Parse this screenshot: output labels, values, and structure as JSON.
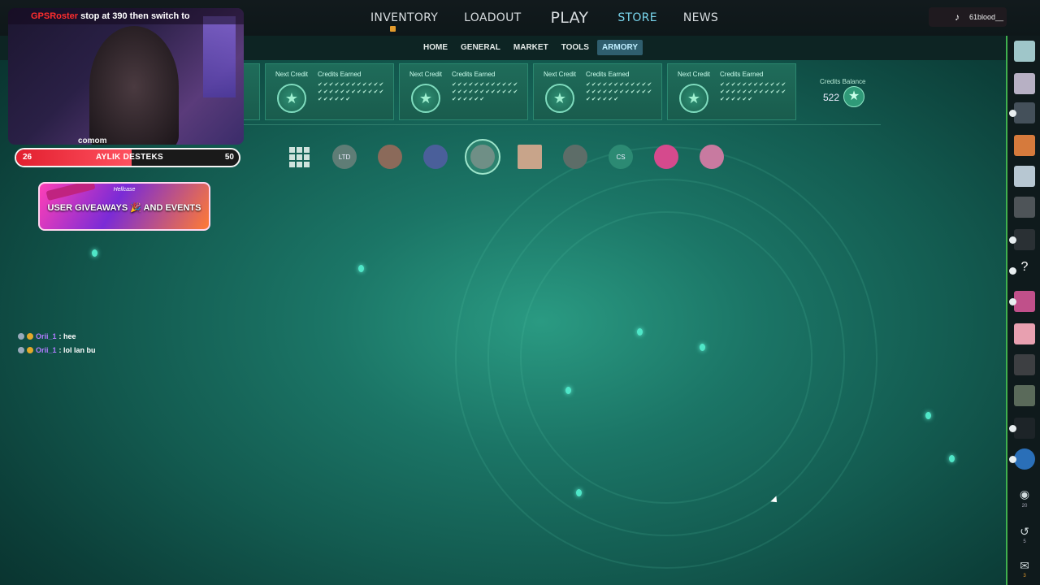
{
  "nav": {
    "items": [
      {
        "label": "INVENTORY",
        "active": false,
        "badge": true
      },
      {
        "label": "LOADOUT",
        "active": false
      },
      {
        "label": "PLAY",
        "active": false
      },
      {
        "label": "STORE",
        "active": true
      },
      {
        "label": "NEWS",
        "active": false
      }
    ]
  },
  "subnav": {
    "items": [
      {
        "label": "HOME",
        "active": false
      },
      {
        "label": "GENERAL",
        "active": false
      },
      {
        "label": "MARKET",
        "active": false
      },
      {
        "label": "TOOLS",
        "active": false
      },
      {
        "label": "ARMORY",
        "active": true
      }
    ]
  },
  "tiktok": {
    "handle": "61blood__",
    "icon": "tiktok-icon"
  },
  "credits": {
    "next_label": "Next Credit",
    "earned_label": "Credits Earned",
    "cards": 4,
    "balance_label": "Credits Balance",
    "balance_value": "522"
  },
  "categories": [
    {
      "name": "all-items-grid",
      "label": ""
    },
    {
      "name": "limited-collection",
      "label": "LTD"
    },
    {
      "name": "charm-collection",
      "label": ""
    },
    {
      "name": "sticker-collection",
      "label": ""
    },
    {
      "name": "armory-pass",
      "label": "",
      "selected": true
    },
    {
      "name": "graffiti-collection",
      "label": ""
    },
    {
      "name": "case-collection",
      "label": ""
    },
    {
      "name": "cs-collection",
      "label": "CS"
    },
    {
      "name": "skin-collection",
      "label": ""
    },
    {
      "name": "agent-collection",
      "label": ""
    }
  ],
  "stream": {
    "title_red": "GPSRoster",
    "title": "stop at 390 then switch to",
    "caption": "comom",
    "goal": {
      "label": "AYLIK DESTEKS",
      "current": "26",
      "target": "50",
      "progress": 0.52
    },
    "promo": {
      "brand": "Hellcase",
      "text": "USER GIVEAWAYS 🎉 AND EVENTS"
    },
    "chat": [
      {
        "user": "Orii_1",
        "message": ": hee"
      },
      {
        "user": "Orii_1",
        "message": ": lol lan bu"
      }
    ]
  },
  "sidebar": {
    "utils": [
      {
        "icon": "broadcast-icon",
        "count": "20"
      },
      {
        "icon": "history-icon",
        "count": "5"
      },
      {
        "icon": "mail-icon",
        "count": "3"
      }
    ]
  },
  "colors": {
    "accent": "#79d6ee",
    "credit_card": "#1f6c5a",
    "goal_fill": "#e21f2f",
    "particle": "#4fe7c8"
  }
}
